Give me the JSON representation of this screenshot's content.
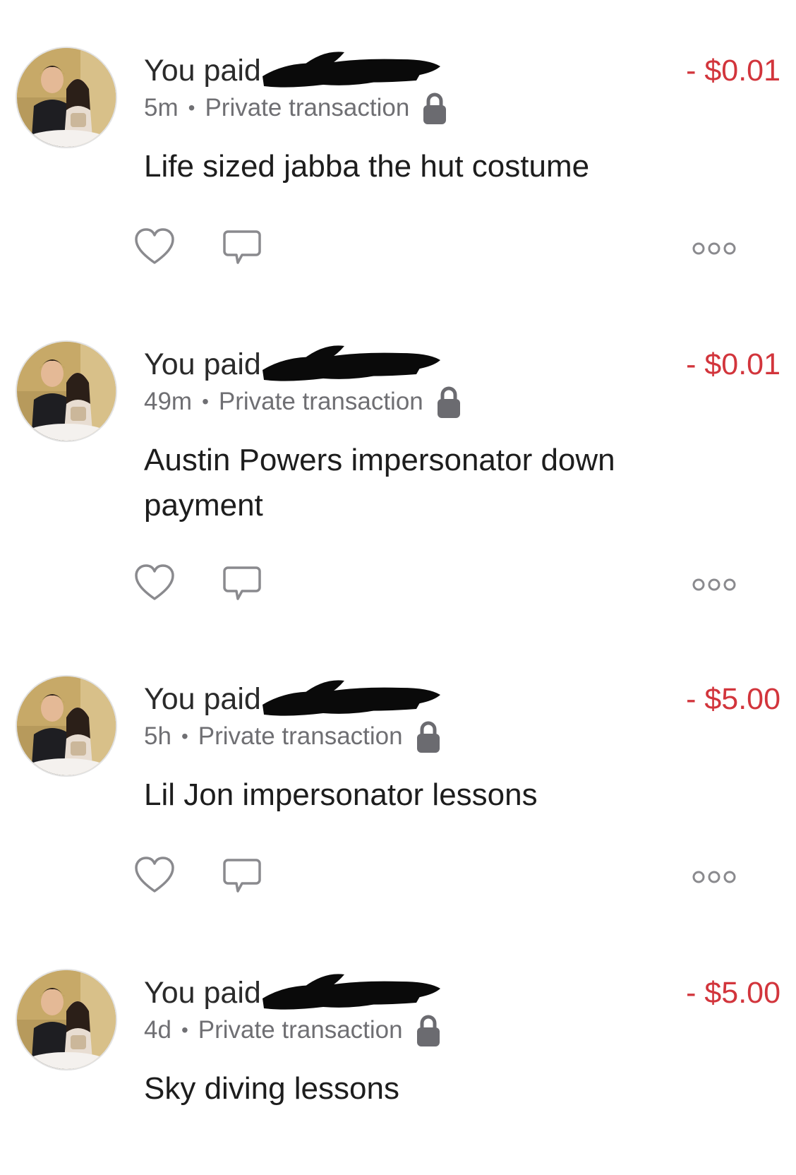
{
  "feed": {
    "stories": [
      {
        "action_text": "You paid",
        "time": "5m",
        "separator": "•",
        "privacy": "Private transaction",
        "privacy_icon": "lock-icon",
        "amount": "- $0.01",
        "note": "Life sized jabba the hut costume"
      },
      {
        "action_text": "You paid",
        "time": "49m",
        "separator": "•",
        "privacy": "Private transaction",
        "privacy_icon": "lock-icon",
        "amount": "- $0.01",
        "note": "Austin Powers impersonator down payment"
      },
      {
        "action_text": "You paid",
        "time": "5h",
        "separator": "•",
        "privacy": "Private transaction",
        "privacy_icon": "lock-icon",
        "amount": "- $5.00",
        "note": "Lil Jon impersonator lessons"
      },
      {
        "action_text": "You paid",
        "time": "4d",
        "separator": "•",
        "privacy": "Private transaction",
        "privacy_icon": "lock-icon",
        "amount": "- $5.00",
        "note": "Sky diving lessons"
      }
    ],
    "icons": {
      "like": "heart-icon",
      "comment": "comment-icon",
      "more": "more-options-icon"
    }
  },
  "colors": {
    "amount_red": "#d2353c",
    "meta_gray": "#6f6f73",
    "icon_gray": "#8a8a8e",
    "lock_gray": "#6b6b70",
    "text_dark": "#1d1d1d"
  }
}
